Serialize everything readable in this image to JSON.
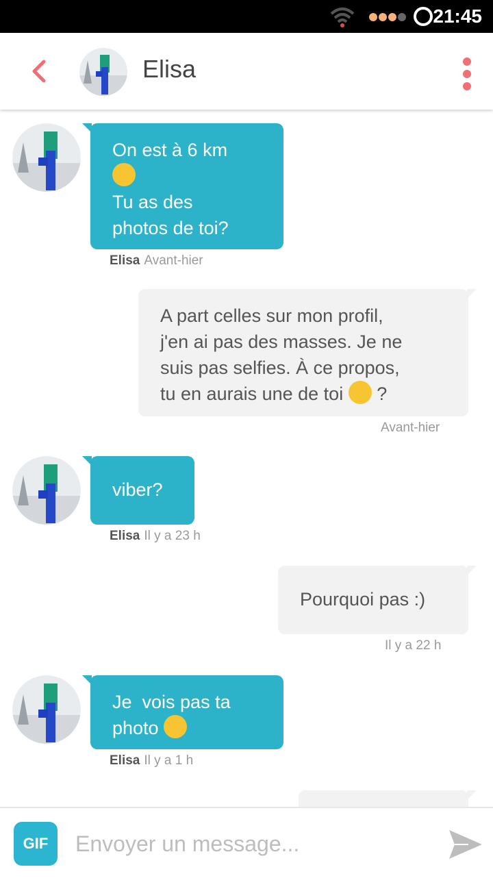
{
  "status_bar": {
    "time": "21:45"
  },
  "header": {
    "contact_name": "Elisa"
  },
  "messages": [
    {
      "from": "Elisa",
      "lines": [
        "On est à 6 km",
        "😉",
        "Tu as des",
        "photos de toi?"
      ],
      "sender": "Elisa",
      "time": "Avant-hier"
    },
    {
      "from": "me",
      "lines": [
        "A part celles sur mon profil,",
        "j'en ai pas des masses. Je ne",
        "suis pas selfies. À ce propos,",
        "tu en aurais une de toi 😜 ?"
      ],
      "time": "Avant-hier"
    },
    {
      "from": "Elisa",
      "text": "viber?",
      "sender": "Elisa",
      "time": "Il y a 23 h"
    },
    {
      "from": "me",
      "text": "Pourquoi pas :)",
      "time": "Il y a 22 h"
    },
    {
      "from": "Elisa",
      "lines": [
        "Je  vois pas ta",
        "photo 😉"
      ],
      "sender": "Elisa",
      "time": "Il y a 1 h"
    }
  ],
  "composer": {
    "gif_label": "GIF",
    "placeholder": "Envoyer un message..."
  },
  "colors": {
    "accent": "#2db3c9",
    "outgoing_bg": "#f2f2f2",
    "icon_red": "#f06f76"
  }
}
